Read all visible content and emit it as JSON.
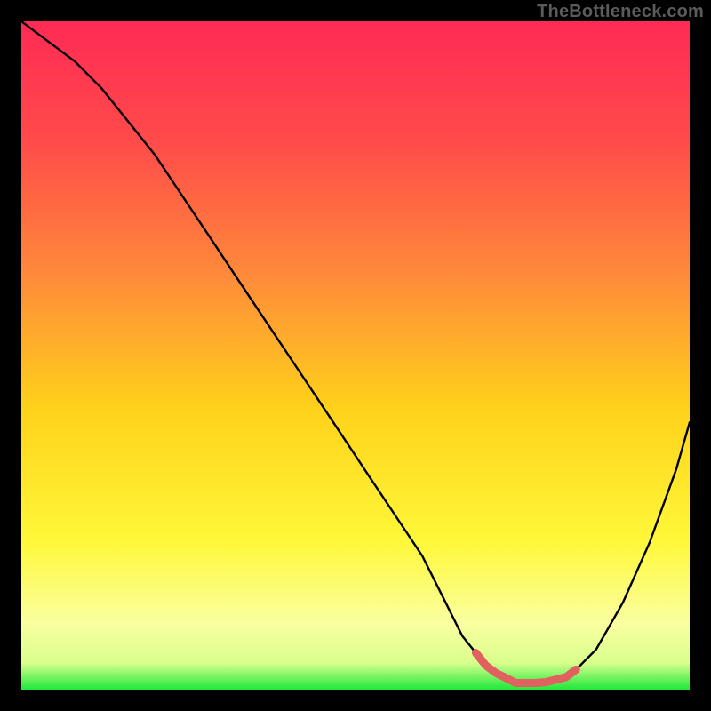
{
  "watermark": "TheBottleneck.com",
  "chart_data": {
    "type": "line",
    "title": "",
    "xlabel": "",
    "ylabel": "",
    "xlim": [
      0,
      100
    ],
    "ylim": [
      0,
      100
    ],
    "grid": false,
    "legend": false,
    "series": [
      {
        "name": "bottleneck-curve",
        "x": [
          0,
          4,
          8,
          12,
          16,
          20,
          24,
          28,
          32,
          36,
          40,
          44,
          48,
          52,
          56,
          60,
          63,
          66,
          70,
          74,
          78,
          82,
          86,
          90,
          94,
          98,
          100
        ],
        "values": [
          100,
          97,
          94,
          90,
          85,
          80,
          74,
          68,
          62,
          56,
          50,
          44,
          38,
          32,
          26,
          20,
          14,
          8,
          3,
          1,
          1,
          2,
          6,
          13,
          22,
          33,
          40
        ]
      }
    ],
    "annotations": [
      {
        "name": "recommended-range",
        "x_start": 68,
        "x_end": 84,
        "color": "#e16060"
      }
    ],
    "background_gradient_stops": [
      {
        "offset": 0.0,
        "color": "#ff2a55"
      },
      {
        "offset": 0.18,
        "color": "#ff4b4a"
      },
      {
        "offset": 0.38,
        "color": "#ff8a3a"
      },
      {
        "offset": 0.58,
        "color": "#ffd21a"
      },
      {
        "offset": 0.78,
        "color": "#fff83a"
      },
      {
        "offset": 0.9,
        "color": "#faffa0"
      },
      {
        "offset": 0.96,
        "color": "#d9ff8c"
      },
      {
        "offset": 1.0,
        "color": "#1ee83c"
      }
    ]
  }
}
